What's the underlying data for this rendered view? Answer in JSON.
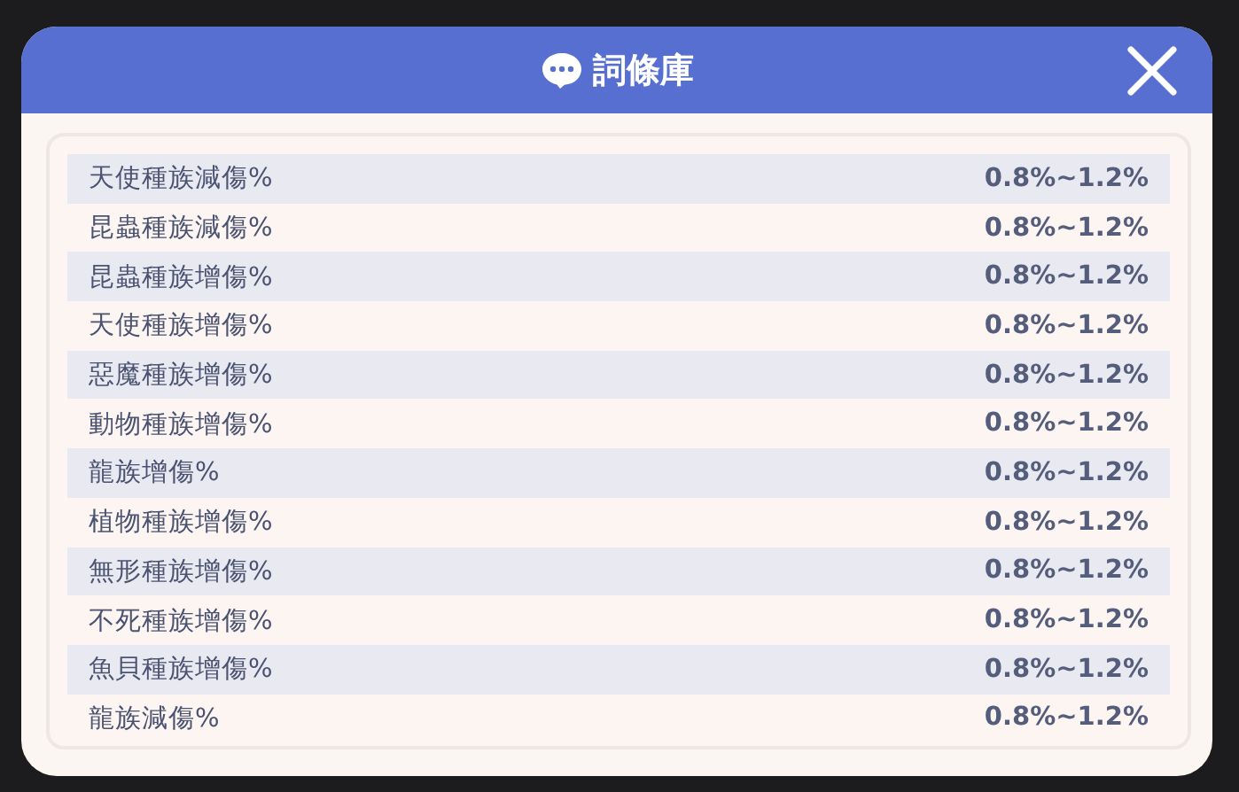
{
  "dialog": {
    "title": "詞條庫"
  },
  "entries": [
    {
      "name": "天使種族減傷%",
      "value": "0.8%~1.2%"
    },
    {
      "name": "昆蟲種族減傷%",
      "value": "0.8%~1.2%"
    },
    {
      "name": "昆蟲種族增傷%",
      "value": "0.8%~1.2%"
    },
    {
      "name": "天使種族增傷%",
      "value": "0.8%~1.2%"
    },
    {
      "name": "惡魔種族增傷%",
      "value": "0.8%~1.2%"
    },
    {
      "name": "動物種族增傷%",
      "value": "0.8%~1.2%"
    },
    {
      "name": "龍族增傷%",
      "value": "0.8%~1.2%"
    },
    {
      "name": "植物種族增傷%",
      "value": "0.8%~1.2%"
    },
    {
      "name": "無形種族增傷%",
      "value": "0.8%~1.2%"
    },
    {
      "name": "不死種族增傷%",
      "value": "0.8%~1.2%"
    },
    {
      "name": "魚貝種族增傷%",
      "value": "0.8%~1.2%"
    },
    {
      "name": "龍族減傷%",
      "value": "0.8%~1.2%"
    }
  ]
}
